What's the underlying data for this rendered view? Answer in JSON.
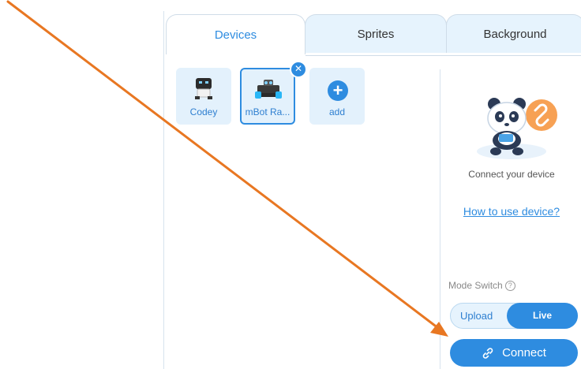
{
  "tabs": [
    {
      "label": "Devices",
      "active": true
    },
    {
      "label": "Sprites",
      "active": false
    },
    {
      "label": "Background",
      "active": false
    }
  ],
  "devices": [
    {
      "label": "Codey",
      "icon": "codey-robot-icon"
    },
    {
      "label": "mBot Ra...",
      "icon": "mbot-ranger-robot-icon",
      "selected": true
    },
    {
      "label": "add",
      "icon": "plus-icon"
    }
  ],
  "remove_icon": "close-icon",
  "sidebar": {
    "illustration": "panda-illustration",
    "connect_text": "Connect your device",
    "howto_link": "How to use device?",
    "mode_label": "Mode Switch",
    "mode_help_icon": "question-icon",
    "mode_upload": "Upload",
    "mode_live": "Live",
    "mode_selected": "Live",
    "connect_button": "Connect",
    "connect_icon": "link-icon"
  },
  "colors": {
    "accent": "#2e8ce0",
    "tab_inactive": "#e6f3fd",
    "tile_bg": "#e3f1fc",
    "annotation_arrow": "#e87722"
  }
}
